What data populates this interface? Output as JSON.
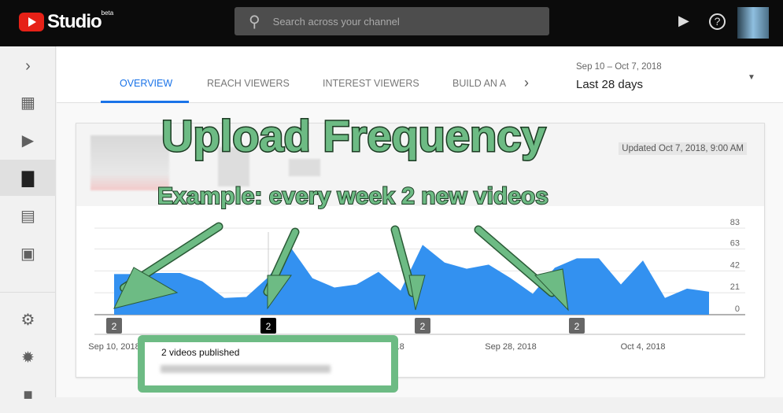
{
  "app": {
    "name": "Studio",
    "badge": "beta"
  },
  "search": {
    "placeholder": "Search across your channel",
    "icon": "search-icon"
  },
  "topbar_icons": [
    "create-video-icon",
    "help-icon"
  ],
  "sidebar": {
    "items": [
      {
        "icon": "expand-chevron-icon",
        "active": false
      },
      {
        "icon": "dashboard-icon",
        "active": false
      },
      {
        "icon": "videos-icon",
        "active": false
      },
      {
        "icon": "analytics-icon",
        "active": true
      },
      {
        "icon": "comments-icon",
        "active": false
      },
      {
        "icon": "transcriptions-icon",
        "active": false
      },
      {
        "icon": "settings-icon",
        "active": false
      },
      {
        "icon": "feedback-icon",
        "active": false
      },
      {
        "icon": "report-icon",
        "active": false
      }
    ]
  },
  "tabs": [
    {
      "label": "OVERVIEW",
      "active": true
    },
    {
      "label": "REACH VIEWERS"
    },
    {
      "label": "INTEREST VIEWERS"
    },
    {
      "label": "BUILD AN A"
    }
  ],
  "date_range": {
    "dates": "Sep 10 – Oct 7, 2018",
    "period": "Last 28 days"
  },
  "card": {
    "updated": "Updated Oct 7, 2018, 9:00 AM"
  },
  "annotation": {
    "title": "Upload Frequency",
    "subtitle": "Example: every week 2 new videos"
  },
  "tooltip": {
    "title": "2 videos published"
  },
  "colors": {
    "area": "#3391f0",
    "annotation": "#6dbb84",
    "accent": "#1a73e8"
  },
  "chart_data": {
    "type": "area",
    "x_start": "Sep 10, 2018",
    "values": [
      39,
      39,
      40,
      40,
      32,
      16,
      17,
      36,
      65,
      35,
      26,
      29,
      41,
      23,
      67,
      50,
      44,
      48,
      35,
      20,
      45,
      54,
      54,
      29,
      52,
      16,
      25,
      22
    ],
    "yticks": [
      0,
      21,
      42,
      63,
      83
    ],
    "ylim": [
      0,
      83
    ],
    "xtick_labels": [
      {
        "day": 0,
        "label": "Sep 10, 2018"
      },
      {
        "day": 12,
        "label": "Sep 22, 2018"
      },
      {
        "day": 18,
        "label": "Sep 28, 2018"
      },
      {
        "day": 24,
        "label": "Oct 4, 2018"
      }
    ],
    "publish_markers": [
      {
        "day": 0,
        "count": "2"
      },
      {
        "day": 7,
        "count": "2",
        "selected": true
      },
      {
        "day": 14,
        "count": "2"
      },
      {
        "day": 21,
        "count": "2"
      }
    ],
    "grid": true
  }
}
